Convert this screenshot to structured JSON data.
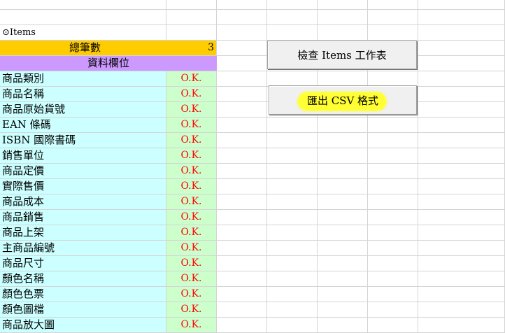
{
  "sheet": {
    "section_title": "⊙Items",
    "total_label": "總筆數",
    "total_value": "3",
    "fields_header": "資料欄位",
    "fields": [
      {
        "name": "商品類別",
        "status": "O.K."
      },
      {
        "name": "商品名稱",
        "status": "O.K."
      },
      {
        "name": "商品原始貨號",
        "status": "O.K."
      },
      {
        "name": "EAN 條碼",
        "status": "O.K."
      },
      {
        "name": "ISBN 國際書碼",
        "status": "O.K."
      },
      {
        "name": "銷售單位",
        "status": "O.K."
      },
      {
        "name": "商品定價",
        "status": "O.K."
      },
      {
        "name": "實際售價",
        "status": "O.K."
      },
      {
        "name": "商品成本",
        "status": "O.K."
      },
      {
        "name": "商品銷售",
        "status": "O.K."
      },
      {
        "name": "商品上架",
        "status": "O.K."
      },
      {
        "name": "主商品編號",
        "status": "O.K."
      },
      {
        "name": "商品尺寸",
        "status": "O.K."
      },
      {
        "name": "顏色名稱",
        "status": "O.K."
      },
      {
        "name": "顏色色票",
        "status": "O.K."
      },
      {
        "name": "顏色圖檔",
        "status": "O.K."
      },
      {
        "name": "商品放大圖",
        "status": "O.K."
      }
    ]
  },
  "buttons": {
    "check_label": "檢查 Items 工作表",
    "export_label": "匯出 CSV 格式"
  },
  "colors": {
    "field_name_bg": "#ccffff",
    "status_bg": "#ccffcc",
    "status_text": "#ff0000",
    "total_bg": "#ffcc00",
    "header_bg": "#cc99ff",
    "highlight": "#ffff33"
  }
}
